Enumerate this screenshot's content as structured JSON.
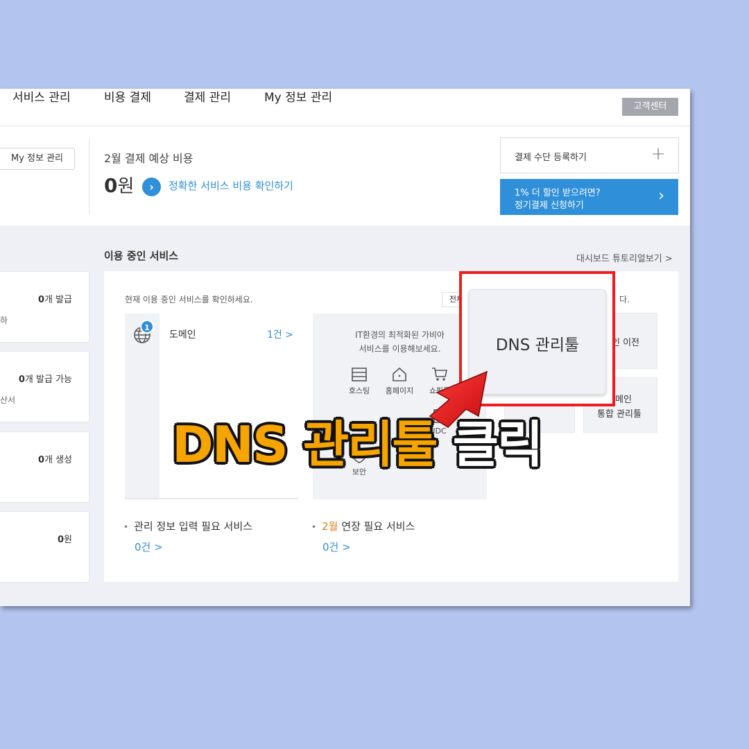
{
  "nav": {
    "items": [
      "서비스 관리",
      "비용 결제",
      "결제 관리",
      "My 정보 관리"
    ],
    "support": "고객센터"
  },
  "summary": {
    "myinfo_button": "My 정보 관리",
    "bill_label": "2월 결제 예상 비용",
    "bill_amount": "0",
    "bill_unit": "원",
    "bill_link": "정확한 서비스 비용 확인하기",
    "payment_register": "결제 수단 등록하기",
    "autopay_line1": "1% 더 할인 받으려면?",
    "autopay_line2": "정기결제 신청하기"
  },
  "left_cards": [
    {
      "count": "0",
      "value": "개 발급",
      "sub": "하"
    },
    {
      "count": "0",
      "value": "개 발급 가능",
      "sub": "산서"
    },
    {
      "count": "0",
      "value": "개 생성",
      "sub": ""
    },
    {
      "count": "0",
      "value": "원",
      "sub": ""
    }
  ],
  "services": {
    "title": "이용 중인 서비스",
    "tutorial": "대시보드 튜토리얼보기 >",
    "desc": "현재 이용 중인 서비스를 확인하세요.",
    "all_button": "전체",
    "tail_text": "다.",
    "domain": {
      "badge": "1",
      "label": "도메인",
      "count": "1건 >"
    },
    "promo": {
      "line1": "IT환경의 최적화된 가비아",
      "line2": "서비스를 이용해보세요.",
      "items": [
        "호스팅",
        "홈페이지",
        "쇼핑몰",
        "IDC",
        "보안"
      ]
    },
    "right_cards": {
      "transfer": "인 이전",
      "integrated_l1": "메인",
      "integrated_l2": "통합 관리툴"
    },
    "bottom": {
      "mgmt_label": "관리 정보 입력 필요 서비스",
      "mgmt_count": "0건 >",
      "renew_highlight": "2월",
      "renew_label": " 연장 필요 서비스",
      "renew_count": "0건 >"
    }
  },
  "overlay": {
    "zoom_label": "DNS 관리툴",
    "caption_main": "DNS 관리툴",
    "caption_action": "클릭",
    "highlight_color": "#ee1c1c",
    "caption_color": "#f6a400"
  }
}
